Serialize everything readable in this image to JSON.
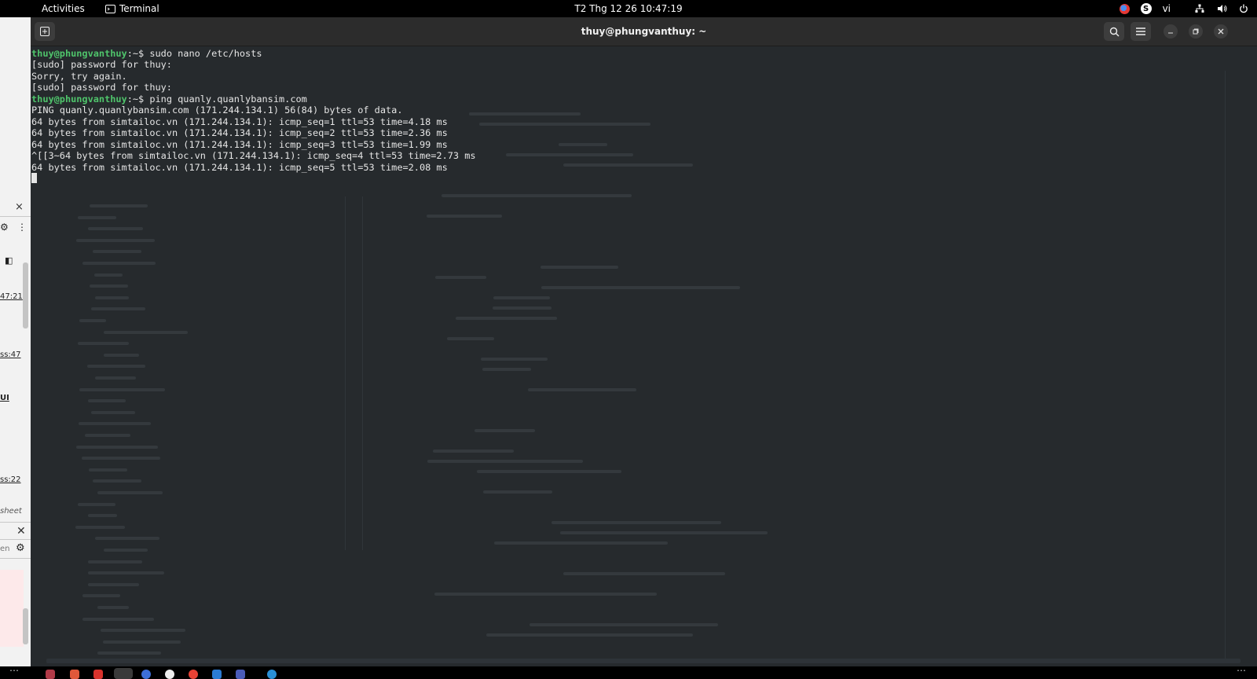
{
  "topbar": {
    "activities": "Activities",
    "app_name": "Terminal",
    "clock": "T2 Thg 12 26  10:47:19",
    "input_language": "vi"
  },
  "terminal": {
    "title": "thuy@phungvanthuy: ~",
    "lines": [
      {
        "user": "thuy@phungvanthuy",
        "path": ":~",
        "cmd": "$ sudo nano /etc/hosts"
      },
      {
        "text": "[sudo] password for thuy:"
      },
      {
        "text": "Sorry, try again."
      },
      {
        "text": "[sudo] password for thuy:"
      },
      {
        "user": "thuy@phungvanthuy",
        "path": ":~",
        "cmd": "$ ping quanly.quanlybansim.com"
      },
      {
        "text": "PING quanly.quanlybansim.com (171.244.134.1) 56(84) bytes of data."
      },
      {
        "text": "64 bytes from simtailoc.vn (171.244.134.1): icmp_seq=1 ttl=53 time=4.18 ms"
      },
      {
        "text": "64 bytes from simtailoc.vn (171.244.134.1): icmp_seq=2 ttl=53 time=2.36 ms"
      },
      {
        "text": "64 bytes from simtailoc.vn (171.244.134.1): icmp_seq=3 ttl=53 time=1.99 ms"
      },
      {
        "text": "^[[3~64 bytes from simtailoc.vn (171.244.134.1): icmp_seq=4 ttl=53 time=2.73 ms"
      },
      {
        "text": "64 bytes from simtailoc.vn (171.244.134.1): icmp_seq=5 ttl=53 time=2.08 ms"
      }
    ]
  },
  "left_window": {
    "times": [
      "47:21",
      "ss:47",
      "ss:22"
    ],
    "labels": [
      "UI",
      "sheet",
      "en"
    ]
  },
  "dock": {
    "show_apps_label": "⋯"
  },
  "colors": {
    "terminal_bg": "#262a2d",
    "prompt_user": "#4fc46b",
    "topbar_bg": "#000000"
  }
}
